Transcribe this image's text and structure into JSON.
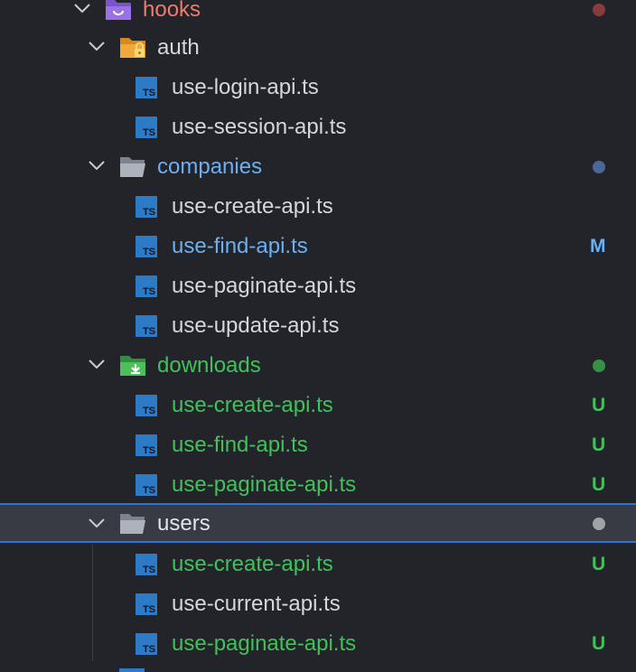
{
  "colors": {
    "background": "#22242a",
    "text_default": "#d4d7dd",
    "text_modified": "#6ab0f3",
    "text_untracked": "#3fc25a",
    "text_red": "#ef7a6e",
    "dot_red": "#8a3c3c",
    "dot_blue": "#4b6797",
    "dot_green": "#379145",
    "dot_gray": "#a0a3a8",
    "selection_border": "#2b74d3",
    "ts_icon": "#2d7ac7"
  },
  "file_icon_text": "TS",
  "tree": {
    "hooks": {
      "label": "hooks",
      "icon": "hooks-folder-icon"
    },
    "auth": {
      "label": "auth",
      "icon": "lock-folder-icon",
      "files": [
        "use-login-api.ts",
        "use-session-api.ts"
      ]
    },
    "companies": {
      "label": "companies",
      "icon": "open-folder-icon",
      "files": [
        "use-create-api.ts",
        "use-find-api.ts",
        "use-paginate-api.ts",
        "use-update-api.ts"
      ],
      "file_badges": [
        "",
        "M",
        "",
        ""
      ]
    },
    "downloads": {
      "label": "downloads",
      "icon": "download-folder-icon",
      "files": [
        "use-create-api.ts",
        "use-find-api.ts",
        "use-paginate-api.ts"
      ],
      "file_badges": [
        "U",
        "U",
        "U"
      ]
    },
    "users": {
      "label": "users",
      "icon": "open-folder-icon",
      "files": [
        "use-create-api.ts",
        "use-current-api.ts",
        "use-paginate-api.ts"
      ],
      "file_badges": [
        "U",
        "",
        "U"
      ]
    }
  }
}
